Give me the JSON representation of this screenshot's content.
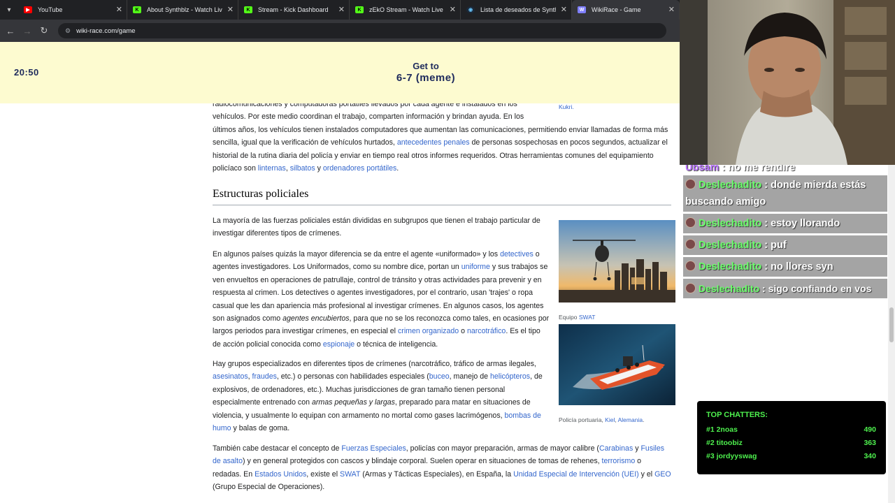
{
  "browser": {
    "tabs": [
      {
        "label": "YouTube",
        "favicon": "youtube-icon",
        "color": "#ff0000"
      },
      {
        "label": "About Synthblz - Watch Live on Kick",
        "favicon": "kick-icon",
        "color": "#53fc18"
      },
      {
        "label": "Stream - Kick Dashboard",
        "favicon": "kick-icon",
        "color": "#53fc18"
      },
      {
        "label": "zEkO Stream - Watch Live on Kick",
        "favicon": "kick-icon",
        "color": "#53fc18"
      },
      {
        "label": "Lista de deseados de Synth",
        "favicon": "steam-icon",
        "color": "#66c0f4"
      },
      {
        "label": "WikiRace - Game",
        "favicon": "wikirace-icon",
        "color": "#7f7fff"
      }
    ],
    "url": "wiki-race.com/game"
  },
  "game": {
    "timer": "20:50",
    "get_to": "Get to",
    "target": "6-7 (meme)"
  },
  "article": {
    "caption_top": "Kukri.",
    "p1_line1": "radiocomunicaciones y computadoras portátiles llevados por cada agente e instalados en los",
    "p1_line2": "vehículos. Por este medio coordinan el trabajo, comparten información y brindan ayuda. En los",
    "p1_line3": "últimos años, los vehículos tienen instalados computadores que aumentan las comunicaciones, permitiendo enviar llamadas de forma más",
    "p1_line4a": "sencilla, igual que la verificación de vehículos hurtados,",
    "p1_link1": "antecedentes penales",
    "p1_line4b": "de personas sospechosas en pocos segundos, actualizar el",
    "p1_line5": "historial de la rutina diaria del policía y enviar en tiempo real otros informes requeridos. Otras herramientas comunes del equipamiento",
    "p1_line6a": "policíaco son",
    "p1_link2": "linternas",
    "p1_link3": "silbatos",
    "p1_line6b": "y",
    "p1_link4": "ordenadores portátiles",
    "heading": "Estructuras policiales",
    "p2": "La mayoría de las fuerzas policiales están divididas en subgrupos que tienen el trabajo particular de investigar diferentes tipos de crímenes.",
    "p3_a": "En algunos países quizás la mayor diferencia se da entre el agente «uniformado» y los",
    "p3_link1": "detectives",
    "p3_b": "o agentes investigadores. Los Uniformados, como su nombre dice, portan un",
    "p3_link2": "uniforme",
    "p3_c": "y sus trabajos se ven envueltos en operaciones de patrullaje, control de tránsito y otras actividades para prevenir y en respuesta al crimen. Los detectives o agentes investigadores, por el contrario, usan 'trajes' o ropa casual que les dan apariencia más profesional al investigar crímenes. En algunos casos, los agentes son asignados como",
    "p3_em": "agentes encubiertos",
    "p3_d": ", para que no se los reconozca como tales, en ocasiones por largos periodos para investigar crímenes, en especial el",
    "p3_link3": "crimen organizado",
    "p3_e": "o",
    "p3_link4": "narcotráfico",
    "p3_f": ". Es el tipo de acción policial conocida como",
    "p3_link5": "espionaje",
    "p3_g": "o técnica de inteligencia.",
    "p4_a": "Hay grupos especializados en diferentes tipos de crímenes (narcotráfico, tráfico de armas ilegales,",
    "p4_link1": "asesinatos",
    "p4_link2": "fraudes",
    "p4_b": ", etc.) o personas con habilidades especiales (",
    "p4_link3": "buceo",
    "p4_c": ", manejo de",
    "p4_link4": "helicópteros",
    "p4_d": ", de explosivos, de ordenadores, etc.). Muchas jurisdicciones de gran tamaño tienen personal especialmente entrenado con",
    "p4_em": "armas pequeñas y largas",
    "p4_e": ", preparado para matar en situaciones de violencia, y usualmente lo equipan con armamento no mortal como gases lacrimógenos,",
    "p4_link5": "bombas de humo",
    "p4_f": "y balas de goma.",
    "p5_a": "También cabe destacar el concepto de",
    "p5_link1": "Fuerzas Especiales",
    "p5_b": ", policías con mayor preparación, armas de mayor calibre (",
    "p5_link2": "Carabinas",
    "p5_c": "y",
    "p5_link3": "Fusiles de asalto",
    "p5_d": ") y en general protegidos con cascos y blindaje corporal. Suelen operar en situaciones de tomas de rehenes,",
    "p5_link4": "terrorismo",
    "p5_e": "o redadas. En",
    "p5_link5": "Estados Unidos",
    "p5_f": ", existe el",
    "p5_link6": "SWAT",
    "p5_g": "(Armas y Tácticas Especiales), en España, la",
    "p5_link7": "Unidad Especial de Intervención (UEI)",
    "p5_h": "y el",
    "p5_link8": "GEO",
    "p5_i": "(Grupo Especial de Operaciones).",
    "fig1_caption_a": "Equipo",
    "fig1_caption_link": "SWAT",
    "fig2_caption_a": "Policía portuaria,",
    "fig2_caption_link1": "Kiel",
    "fig2_caption_link2": "Alemania",
    "fig2_caption_b": "."
  },
  "chat": {
    "messages": [
      {
        "user": "Ubsam",
        "text": ": no me rendire",
        "user_color": "purple"
      },
      {
        "user": "Deslechadito",
        "text": ": donde mierda estás buscando amigo"
      },
      {
        "user": "Deslechadito",
        "text": ": estoy llorando"
      },
      {
        "user": "Deslechadito",
        "text": ": puf"
      },
      {
        "user": "Deslechadito",
        "text": ": no llores syn"
      },
      {
        "user": "Deslechadito",
        "text": ": sigo confiando en vos"
      }
    ]
  },
  "top_chatters": {
    "title": "TOP CHATTERS:",
    "rows": [
      {
        "name": "#1 2noas",
        "count": "490"
      },
      {
        "name": "#2 titoobiz",
        "count": "363"
      },
      {
        "name": "#3 jordyyswag",
        "count": "340"
      }
    ]
  }
}
